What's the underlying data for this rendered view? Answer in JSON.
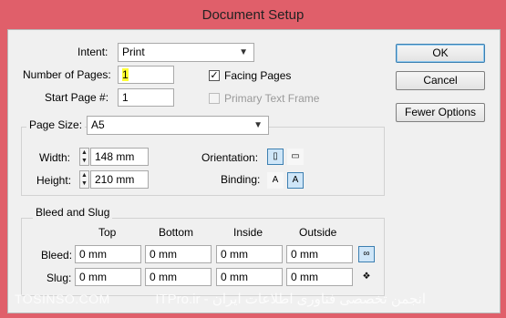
{
  "window": {
    "title": "Document Setup"
  },
  "intent": {
    "label": "Intent:",
    "value": "Print"
  },
  "pages": {
    "label": "Number of Pages:",
    "value": "1"
  },
  "start_page": {
    "label": "Start Page #:",
    "value": "1"
  },
  "facing_pages": {
    "label": "Facing Pages",
    "checked": true
  },
  "primary_text_frame": {
    "label": "Primary Text Frame",
    "checked": false,
    "enabled": false
  },
  "page_size": {
    "label": "Page Size:",
    "value": "A5"
  },
  "width": {
    "label": "Width:",
    "value": "148 mm"
  },
  "height": {
    "label": "Height:",
    "value": "210 mm"
  },
  "orientation": {
    "label": "Orientation:"
  },
  "binding": {
    "label": "Binding:"
  },
  "bleed_slug": {
    "title": "Bleed and Slug",
    "columns": [
      "Top",
      "Bottom",
      "Inside",
      "Outside"
    ],
    "bleed_label": "Bleed:",
    "slug_label": "Slug:",
    "bleed": [
      "0 mm",
      "0 mm",
      "0 mm",
      "0 mm"
    ],
    "slug": [
      "0 mm",
      "0 mm",
      "0 mm",
      "0 mm"
    ]
  },
  "buttons": {
    "ok": "OK",
    "cancel": "Cancel",
    "fewer": "Fewer Options"
  },
  "watermark": {
    "left": "TOSINSO.COM",
    "right": "انجمن تخصصی فناوری اطلاعات ایران - ITPro.ir"
  }
}
